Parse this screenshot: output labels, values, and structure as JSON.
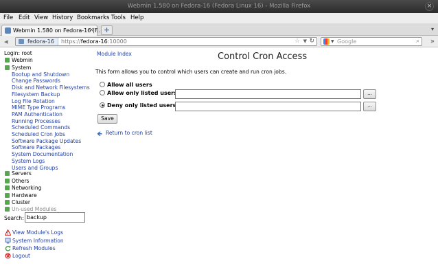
{
  "window": {
    "title": "Webmin 1.580 on Fedora-16 (Fedora Linux 16) - Mozilla Firefox",
    "close_glyph": "×"
  },
  "menubar": [
    "File",
    "Edit",
    "View",
    "History",
    "Bookmarks",
    "Tools",
    "Help"
  ],
  "tab": {
    "title": "Webmin 1.580 on Fedora-16 (F...",
    "close_glyph": "×"
  },
  "urlbar": {
    "identity": "fedora-16",
    "scheme": "https://",
    "host": "fedora-16",
    "port": ":10000"
  },
  "search": {
    "placeholder": "Google"
  },
  "sidebar": {
    "login": "Login: root",
    "categories": [
      "Webmin",
      "System",
      "Servers",
      "Others",
      "Networking",
      "Hardware",
      "Cluster",
      "Un-used Modules"
    ],
    "system_items": [
      "Bootup and Shutdown",
      "Change Passwords",
      "Disk and Network Filesystems",
      "Filesystem Backup",
      "Log File Rotation",
      "MIME Type Programs",
      "PAM Authentication",
      "Running Processes",
      "Scheduled Commands",
      "Scheduled Cron Jobs",
      "Software Package Updates",
      "Software Packages",
      "System Documentation",
      "System Logs",
      "Users and Groups"
    ],
    "search_label": "Search:",
    "search_value": "backup",
    "actions": [
      "View Module's Logs",
      "System Information",
      "Refresh Modules",
      "Logout"
    ]
  },
  "main": {
    "module_index": "Module Index",
    "title": "Control Cron Access",
    "description": "This form allows you to control which users can create and run cron jobs.",
    "options": [
      {
        "label": "Allow all users",
        "selected": false
      },
      {
        "label": "Allow only listed users",
        "selected": false
      },
      {
        "label": "Deny only listed users",
        "selected": true
      }
    ],
    "browse_label": "...",
    "save_label": "Save",
    "return_label": "Return to cron list"
  },
  "colors": {
    "link": "#2140a8",
    "category_icon": "#55a84e"
  }
}
